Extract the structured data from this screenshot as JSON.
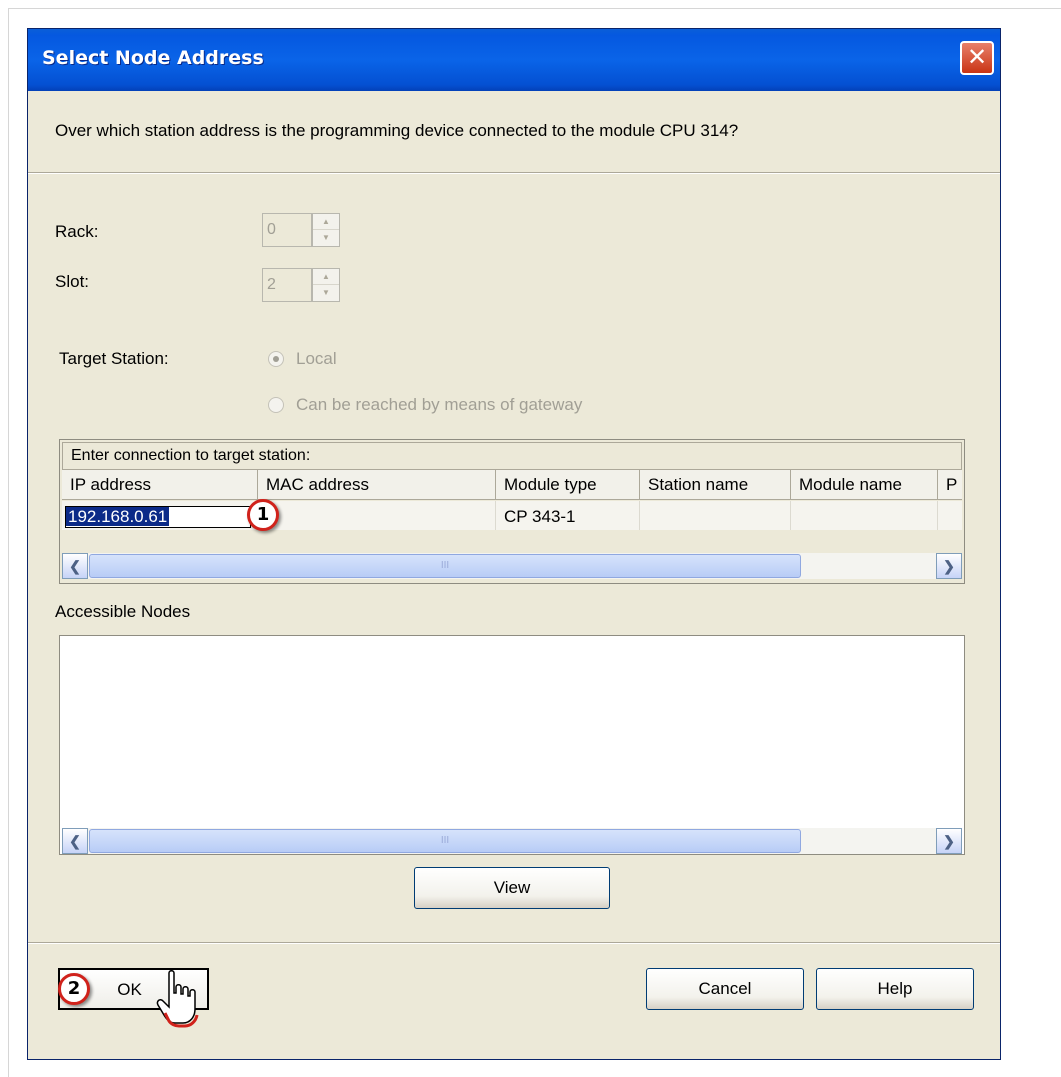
{
  "window": {
    "title": "Select Node Address",
    "close_glyph": "✕"
  },
  "question": "Over which station address is the programming device connected to the module CPU 314?",
  "rack": {
    "label": "Rack:",
    "value": "0"
  },
  "slot": {
    "label": "Slot:",
    "value": "2"
  },
  "target_station": {
    "label": "Target Station:",
    "options": [
      {
        "label": "Local",
        "checked": true
      },
      {
        "label": "Can be reached by means of gateway",
        "checked": false
      }
    ]
  },
  "connection_table": {
    "caption": "Enter connection to target station:",
    "columns": [
      "IP address",
      "MAC address",
      "Module type",
      "Station name",
      "Module name",
      "P"
    ],
    "row": {
      "ip": "192.168.0.61",
      "mac": "",
      "module_type": "CP 343-1",
      "station_name": "",
      "module_name": "",
      "p": ""
    },
    "scroll_grip": "III"
  },
  "accessible_nodes": {
    "label": "Accessible Nodes",
    "scroll_grip": "III"
  },
  "buttons": {
    "view": "View",
    "ok": "OK",
    "cancel": "Cancel",
    "help": "Help"
  },
  "annotations": {
    "badge1": "1",
    "badge2": "2"
  },
  "icons": {
    "scroll_left": "❮",
    "scroll_right": "❯",
    "spin_up": "▲",
    "spin_down": "▼"
  },
  "colors": {
    "titlebar": "#0558e0",
    "dialog_bg": "#ece9d8",
    "selection": "#0b2a88",
    "badge_border": "#d0221b"
  }
}
